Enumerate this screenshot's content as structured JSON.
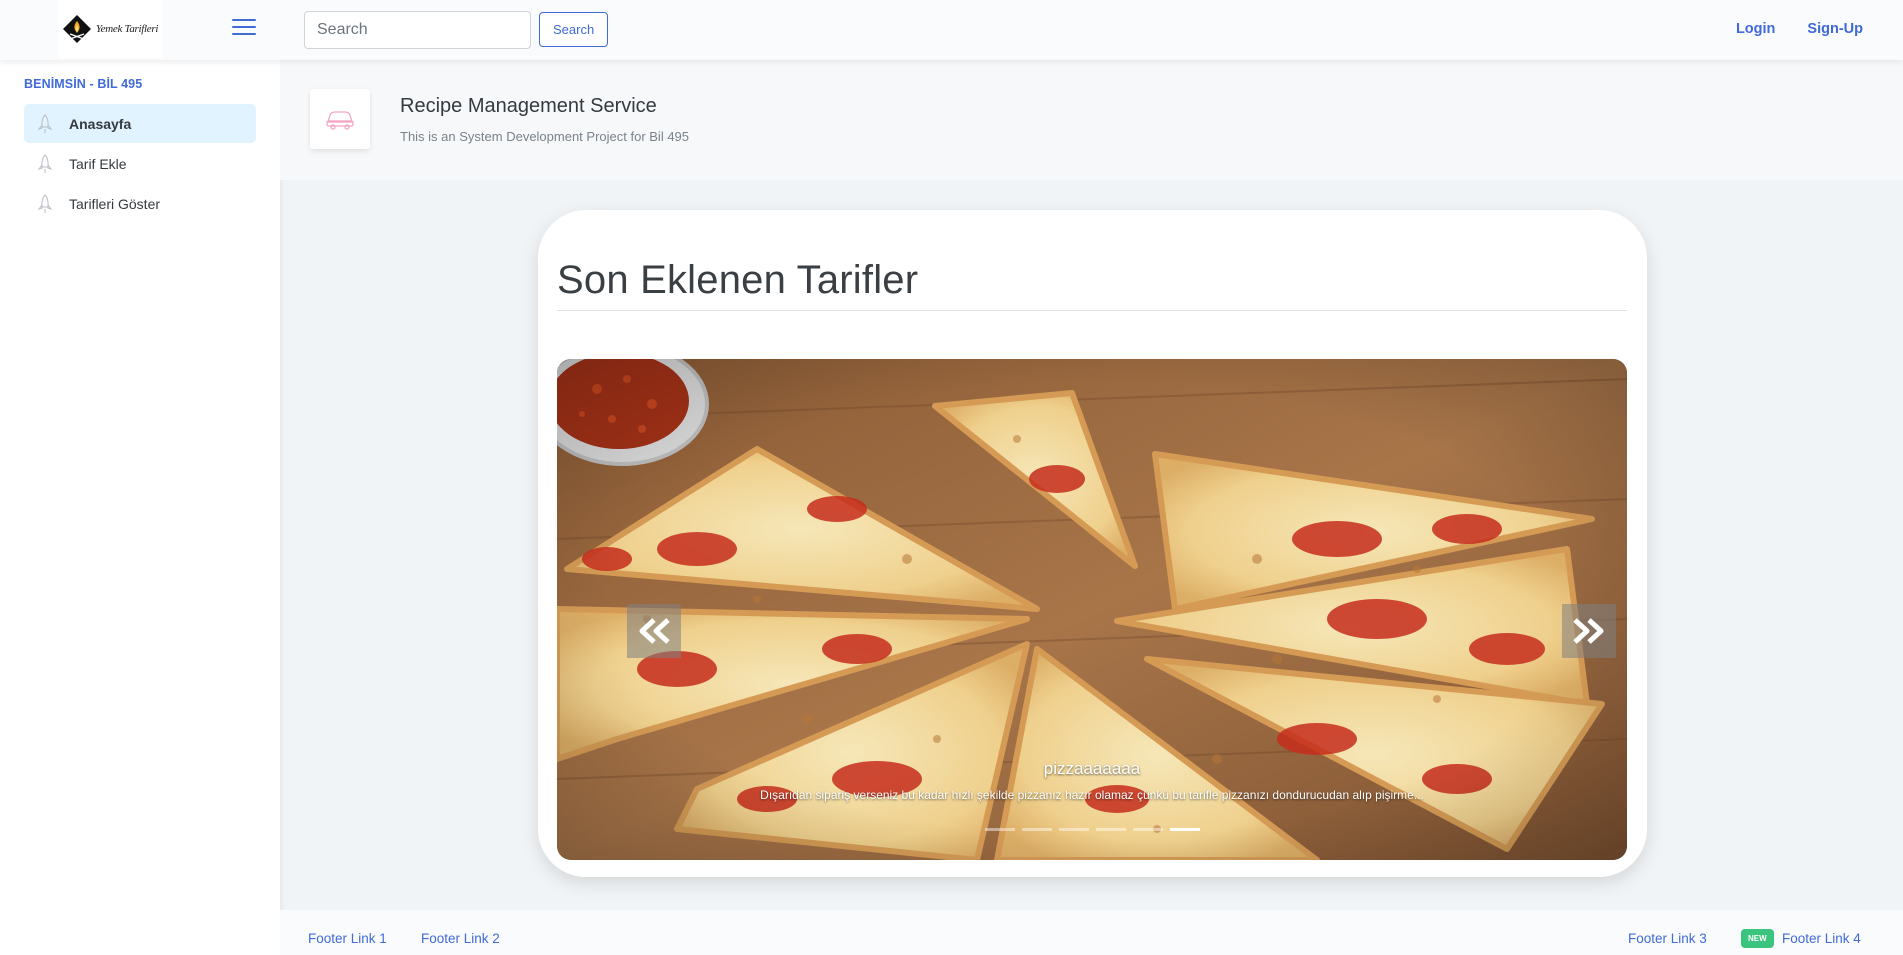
{
  "header": {
    "logo_text": "Yemek Tarifleri",
    "search_placeholder": "Search",
    "search_button": "Search",
    "login": "Login",
    "signup": "Sign-Up"
  },
  "sidebar": {
    "heading": "BENİMSİN - BİL 495",
    "items": [
      {
        "label": "Anasayfa",
        "active": true,
        "icon": "rocket-icon"
      },
      {
        "label": "Tarif Ekle",
        "active": false,
        "icon": "rocket-icon"
      },
      {
        "label": "Tarifleri Göster",
        "active": false,
        "icon": "rocket-icon"
      }
    ]
  },
  "page": {
    "title": "Recipe Management Service",
    "subtitle": "This is an System Development Project for Bil 495",
    "title_icon": "car-icon"
  },
  "main": {
    "heading": "Son Eklenen Tarifler",
    "carousel": {
      "slide_title": "pizzaaaaaaa",
      "slide_text": "Dışarıdan sipariş verseniz bu kadar hızlı şekilde pizzanız hazır olamaz çünkü bu tarifle pizzanızı dondurucudan alıp pişirme...",
      "indicator_count": 6,
      "active_indicator": 5
    }
  },
  "footer": {
    "links": [
      "Footer Link 1",
      "Footer Link 2",
      "Footer Link 3",
      "Footer Link 4"
    ],
    "badge": "NEW"
  },
  "colors": {
    "accent": "#3f6ad8",
    "active_nav_bg": "#e0f3ff",
    "badge_green": "#3ac47d"
  }
}
